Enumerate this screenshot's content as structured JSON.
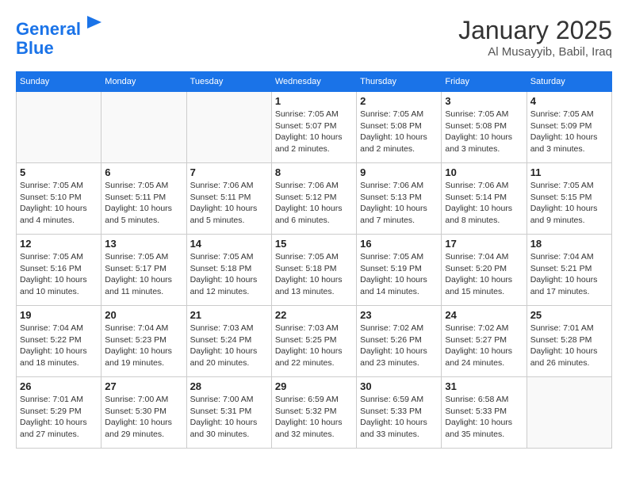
{
  "header": {
    "logo_line1": "General",
    "logo_line2": "Blue",
    "month": "January 2025",
    "location": "Al Musayyib, Babil, Iraq"
  },
  "days_of_week": [
    "Sunday",
    "Monday",
    "Tuesday",
    "Wednesday",
    "Thursday",
    "Friday",
    "Saturday"
  ],
  "weeks": [
    [
      {
        "day": "",
        "info": ""
      },
      {
        "day": "",
        "info": ""
      },
      {
        "day": "",
        "info": ""
      },
      {
        "day": "1",
        "info": "Sunrise: 7:05 AM\nSunset: 5:07 PM\nDaylight: 10 hours\nand 2 minutes."
      },
      {
        "day": "2",
        "info": "Sunrise: 7:05 AM\nSunset: 5:08 PM\nDaylight: 10 hours\nand 2 minutes."
      },
      {
        "day": "3",
        "info": "Sunrise: 7:05 AM\nSunset: 5:08 PM\nDaylight: 10 hours\nand 3 minutes."
      },
      {
        "day": "4",
        "info": "Sunrise: 7:05 AM\nSunset: 5:09 PM\nDaylight: 10 hours\nand 3 minutes."
      }
    ],
    [
      {
        "day": "5",
        "info": "Sunrise: 7:05 AM\nSunset: 5:10 PM\nDaylight: 10 hours\nand 4 minutes."
      },
      {
        "day": "6",
        "info": "Sunrise: 7:05 AM\nSunset: 5:11 PM\nDaylight: 10 hours\nand 5 minutes."
      },
      {
        "day": "7",
        "info": "Sunrise: 7:06 AM\nSunset: 5:11 PM\nDaylight: 10 hours\nand 5 minutes."
      },
      {
        "day": "8",
        "info": "Sunrise: 7:06 AM\nSunset: 5:12 PM\nDaylight: 10 hours\nand 6 minutes."
      },
      {
        "day": "9",
        "info": "Sunrise: 7:06 AM\nSunset: 5:13 PM\nDaylight: 10 hours\nand 7 minutes."
      },
      {
        "day": "10",
        "info": "Sunrise: 7:06 AM\nSunset: 5:14 PM\nDaylight: 10 hours\nand 8 minutes."
      },
      {
        "day": "11",
        "info": "Sunrise: 7:05 AM\nSunset: 5:15 PM\nDaylight: 10 hours\nand 9 minutes."
      }
    ],
    [
      {
        "day": "12",
        "info": "Sunrise: 7:05 AM\nSunset: 5:16 PM\nDaylight: 10 hours\nand 10 minutes."
      },
      {
        "day": "13",
        "info": "Sunrise: 7:05 AM\nSunset: 5:17 PM\nDaylight: 10 hours\nand 11 minutes."
      },
      {
        "day": "14",
        "info": "Sunrise: 7:05 AM\nSunset: 5:18 PM\nDaylight: 10 hours\nand 12 minutes."
      },
      {
        "day": "15",
        "info": "Sunrise: 7:05 AM\nSunset: 5:18 PM\nDaylight: 10 hours\nand 13 minutes."
      },
      {
        "day": "16",
        "info": "Sunrise: 7:05 AM\nSunset: 5:19 PM\nDaylight: 10 hours\nand 14 minutes."
      },
      {
        "day": "17",
        "info": "Sunrise: 7:04 AM\nSunset: 5:20 PM\nDaylight: 10 hours\nand 15 minutes."
      },
      {
        "day": "18",
        "info": "Sunrise: 7:04 AM\nSunset: 5:21 PM\nDaylight: 10 hours\nand 17 minutes."
      }
    ],
    [
      {
        "day": "19",
        "info": "Sunrise: 7:04 AM\nSunset: 5:22 PM\nDaylight: 10 hours\nand 18 minutes."
      },
      {
        "day": "20",
        "info": "Sunrise: 7:04 AM\nSunset: 5:23 PM\nDaylight: 10 hours\nand 19 minutes."
      },
      {
        "day": "21",
        "info": "Sunrise: 7:03 AM\nSunset: 5:24 PM\nDaylight: 10 hours\nand 20 minutes."
      },
      {
        "day": "22",
        "info": "Sunrise: 7:03 AM\nSunset: 5:25 PM\nDaylight: 10 hours\nand 22 minutes."
      },
      {
        "day": "23",
        "info": "Sunrise: 7:02 AM\nSunset: 5:26 PM\nDaylight: 10 hours\nand 23 minutes."
      },
      {
        "day": "24",
        "info": "Sunrise: 7:02 AM\nSunset: 5:27 PM\nDaylight: 10 hours\nand 24 minutes."
      },
      {
        "day": "25",
        "info": "Sunrise: 7:01 AM\nSunset: 5:28 PM\nDaylight: 10 hours\nand 26 minutes."
      }
    ],
    [
      {
        "day": "26",
        "info": "Sunrise: 7:01 AM\nSunset: 5:29 PM\nDaylight: 10 hours\nand 27 minutes."
      },
      {
        "day": "27",
        "info": "Sunrise: 7:00 AM\nSunset: 5:30 PM\nDaylight: 10 hours\nand 29 minutes."
      },
      {
        "day": "28",
        "info": "Sunrise: 7:00 AM\nSunset: 5:31 PM\nDaylight: 10 hours\nand 30 minutes."
      },
      {
        "day": "29",
        "info": "Sunrise: 6:59 AM\nSunset: 5:32 PM\nDaylight: 10 hours\nand 32 minutes."
      },
      {
        "day": "30",
        "info": "Sunrise: 6:59 AM\nSunset: 5:33 PM\nDaylight: 10 hours\nand 33 minutes."
      },
      {
        "day": "31",
        "info": "Sunrise: 6:58 AM\nSunset: 5:33 PM\nDaylight: 10 hours\nand 35 minutes."
      },
      {
        "day": "",
        "info": ""
      }
    ]
  ]
}
